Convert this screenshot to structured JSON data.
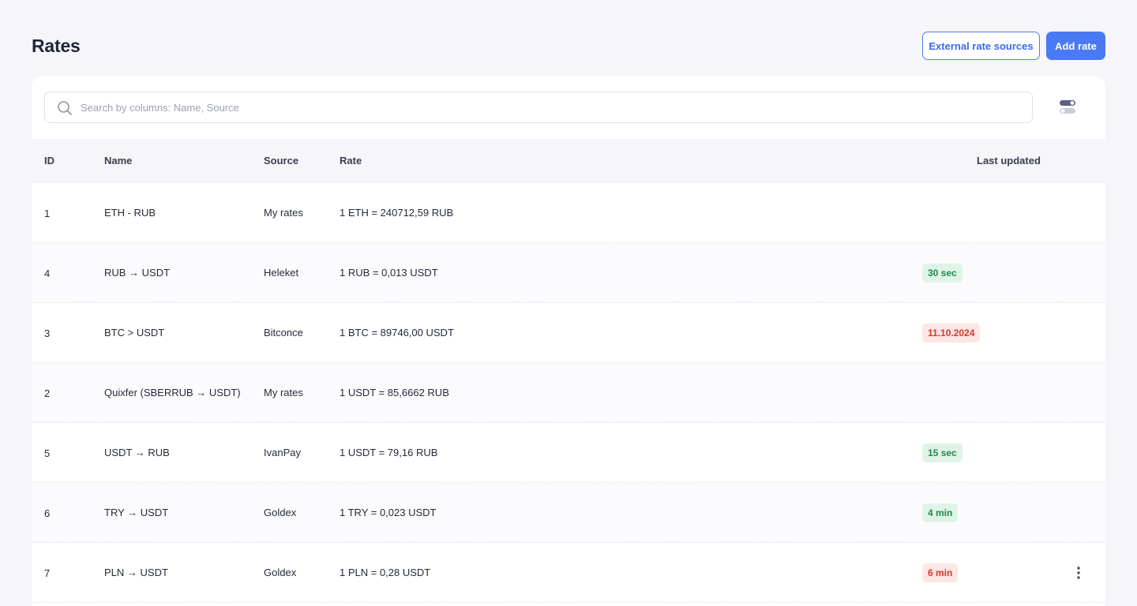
{
  "header": {
    "title": "Rates",
    "external_sources_label": "External rate sources",
    "add_rate_label": "Add rate"
  },
  "search": {
    "placeholder": "Search by columns: Name, Source",
    "value": ""
  },
  "table": {
    "columns": {
      "id": "ID",
      "name": "Name",
      "source": "Source",
      "rate": "Rate",
      "last_updated": "Last updated"
    },
    "rows": [
      {
        "id": "1",
        "name": "ETH - RUB",
        "source": "My rates",
        "rate": "1  ETH = 240712,59  RUB",
        "last_updated": "",
        "status": ""
      },
      {
        "id": "4",
        "name": "RUB → USDT",
        "source": "Heleket",
        "rate": "1 RUB = 0,013 USDT",
        "last_updated": "30 sec",
        "status": "ok"
      },
      {
        "id": "3",
        "name": "BTC > USDT",
        "source": "Bitconce",
        "rate": "1 BTC = 89746,00  USDT",
        "last_updated": "11.10.2024",
        "status": "bad"
      },
      {
        "id": "2",
        "name": "Quixfer (SBERRUB → USDT)",
        "source": "My rates",
        "rate": "1 USDT = 85,6662 RUB",
        "last_updated": "",
        "status": ""
      },
      {
        "id": "5",
        "name": "USDT → RUB",
        "source": "IvanPay",
        "rate": "1 USDT = 79,16  RUB",
        "last_updated": "15 sec",
        "status": "ok"
      },
      {
        "id": "6",
        "name": "TRY → USDT",
        "source": "Goldex",
        "rate": "1 TRY = 0,023 USDT",
        "last_updated": "4 min",
        "status": "ok"
      },
      {
        "id": "7",
        "name": "PLN → USDT",
        "source": "Goldex",
        "rate": "1 PLN = 0,28 USDT",
        "last_updated": "6 min",
        "status": "bad"
      }
    ]
  },
  "icons": {
    "search": "search-icon",
    "columns_toggle": "toggle-columns-icon",
    "row_menu": "more-vertical-icon"
  },
  "colors": {
    "accent": "#4a7af3",
    "badge_ok_bg": "#dff4e7",
    "badge_ok_text": "#1f8a4c",
    "badge_bad_bg": "#fde6e3",
    "badge_bad_text": "#d3392c"
  }
}
